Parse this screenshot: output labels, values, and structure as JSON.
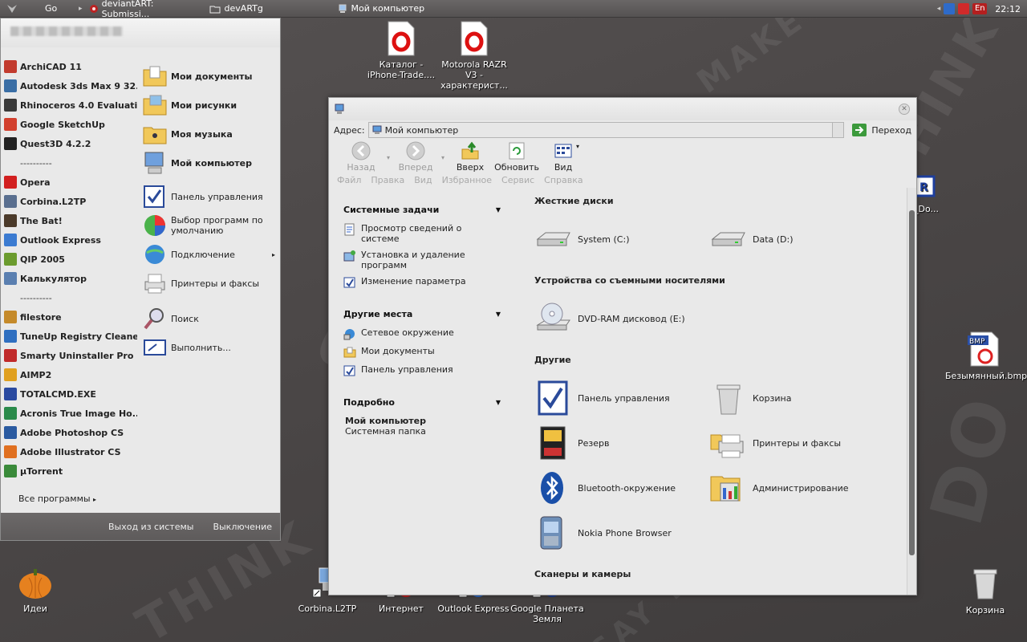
{
  "taskbar": {
    "go_label": "Go",
    "items": [
      "deviantART: Submissi...",
      "devARTg",
      "Мой компьютер"
    ],
    "lang": "En",
    "clock": "22:12"
  },
  "desktop": {
    "icons": {
      "catalog": "Каталог - iPhone-Trade....",
      "motorola": "Motorola RAZR V3 - характерист...",
      "rar_partial": "d_Do...",
      "bmp": "Безымянный.bmp",
      "ideas": "Идеи",
      "corbina": "Corbina.L2TP",
      "internet": "Интернет",
      "outlook": "Outlook Express",
      "google_earth": "Google Планета Земля",
      "recycle": "Корзина"
    },
    "wall_words": [
      "SAY THINK DO",
      "MAKE",
      "SAY",
      "THINK",
      "DO"
    ]
  },
  "startmenu": {
    "programs": [
      {
        "label": "ArchiCAD 11",
        "color": "#c23b2e"
      },
      {
        "label": "Autodesk 3ds Max 9 32...",
        "color": "#3a6ea5"
      },
      {
        "label": "Rhinoceros 4.0 Evaluati...",
        "color": "#3a3a3a"
      },
      {
        "label": "Google SketchUp",
        "color": "#d2402e"
      },
      {
        "label": "Quest3D 4.2.2",
        "color": "#222222"
      }
    ],
    "separator1": "----------",
    "programs2": [
      {
        "label": "Opera",
        "color": "#d22020"
      },
      {
        "label": "Corbina.L2TP",
        "color": "#5a6f8f"
      },
      {
        "label": "The Bat!",
        "color": "#4b3a2a"
      },
      {
        "label": "Outlook Express",
        "color": "#3b7bd1"
      },
      {
        "label": "QIP 2005",
        "color": "#6b9b2e"
      },
      {
        "label": "Калькулятор",
        "color": "#5a7fb0"
      }
    ],
    "separator2": "----------",
    "programs3": [
      {
        "label": "filestore",
        "color": "#c58a2a"
      },
      {
        "label": "TuneUp Registry Cleaner",
        "color": "#2f6fc0"
      },
      {
        "label": "Smarty Uninstaller Pro ...",
        "color": "#c02a2a"
      },
      {
        "label": "AIMP2",
        "color": "#e0a020"
      },
      {
        "label": "TOTALCMD.EXE",
        "color": "#2a4aa0"
      },
      {
        "label": "Acronis True Image Ho...",
        "color": "#2a8a4a"
      },
      {
        "label": "Adobe Photoshop CS",
        "color": "#2a5aa0"
      },
      {
        "label": "Adobe Illustrator CS",
        "color": "#e07020"
      },
      {
        "label": "µTorrent",
        "color": "#3a8a3a"
      }
    ],
    "all_programs": "Все программы",
    "right": {
      "my_docs": "Мои документы",
      "my_pics": "Мои рисунки",
      "my_music": "Моя музыка",
      "my_computer": "Мой компьютер",
      "control_panel": "Панель управления",
      "default_programs": "Выбор программ по умолчанию",
      "connection": "Подключение",
      "printers": "Принтеры и факсы",
      "search": "Поиск",
      "run": "Выполнить..."
    },
    "logoff": "Выход из системы",
    "shutdown": "Выключение"
  },
  "explorer": {
    "address_label": "Адрес:",
    "address_value": "Мой компьютер",
    "go": "Переход",
    "toolbar": {
      "back": "Назад",
      "forward": "Вперед",
      "up": "Вверх",
      "refresh": "Обновить",
      "view": "Вид"
    },
    "menu": [
      "Файл",
      "Правка",
      "Вид",
      "Избранное",
      "Сервис",
      "Справка"
    ],
    "tasks": {
      "system_title": "Системные задачи",
      "system": [
        "Просмотр сведений о системе",
        "Установка и удаление программ",
        "Изменение параметра"
      ],
      "places_title": "Другие места",
      "places": [
        "Сетевое окружение",
        "Мои документы",
        "Панель управления"
      ],
      "details_title": "Подробно",
      "details_name": "Мой компьютер",
      "details_desc": "Системная папка"
    },
    "sections": {
      "hdd": "Жесткие диски",
      "removable": "Устройства со съемными носителями",
      "other": "Другие",
      "scanners": "Сканеры и камеры"
    },
    "items": {
      "c": "System (C:)",
      "d": "Data (D:)",
      "dvd": "DVD-RAM дисковод (E:)",
      "control": "Панель управления",
      "recycle": "Корзина",
      "backup": "Резерв",
      "printers": "Принтеры и факсы",
      "bluetooth": "Bluetooth-окружение",
      "admin": "Администрирование",
      "nokia": "Nokia Phone Browser"
    }
  }
}
